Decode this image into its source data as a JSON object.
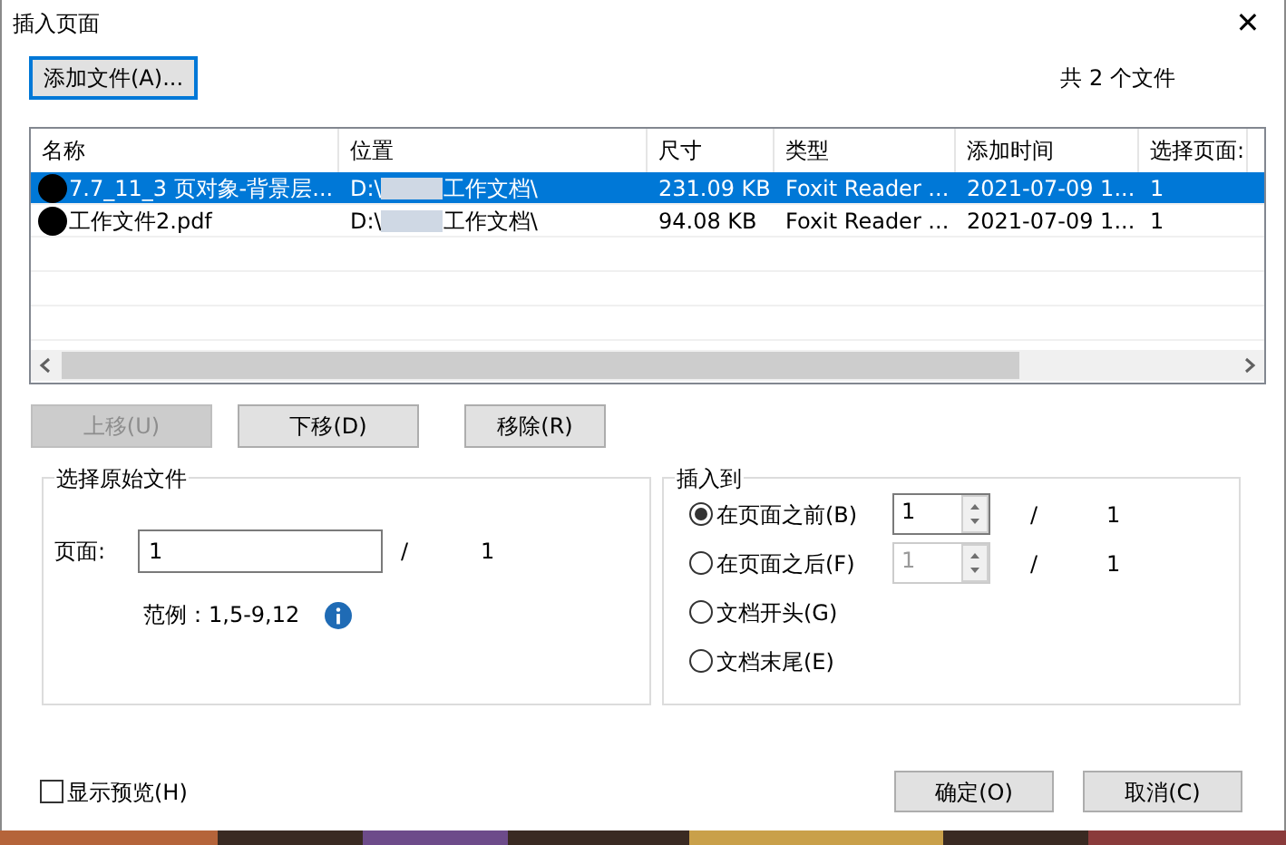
{
  "window": {
    "title": "插入页面",
    "close": "✕"
  },
  "add_button": "添加文件(A)...",
  "file_count": "共 2 个文件",
  "table": {
    "columns": [
      "名称",
      "位置",
      "尺寸",
      "类型",
      "添加时间",
      "选择页面:"
    ],
    "rows": [
      {
        "selected": true,
        "name": "7.7_11_3 页对象-背景层...",
        "location_prefix": "D:\\",
        "location_suffix": "工作文档\\",
        "size": "231.09 KB",
        "type": "Foxit Reader ...",
        "added": "2021-07-09 1...",
        "pages": "1"
      },
      {
        "selected": false,
        "name": "工作文件2.pdf",
        "location_prefix": "D:\\",
        "location_suffix": "工作文档\\",
        "size": "94.08 KB",
        "type": "Foxit Reader ...",
        "added": "2021-07-09 1...",
        "pages": "1"
      }
    ]
  },
  "move_buttons": [
    {
      "label": "上移(U)",
      "disabled": true
    },
    {
      "label": "下移(D)",
      "disabled": false
    },
    {
      "label": "移除(R)",
      "disabled": false
    }
  ],
  "source": {
    "title": "选择原始文件",
    "page_label": "页面:",
    "page_value": "1",
    "slash": "/",
    "page_total": "1",
    "example": "范例：1,5-9,12"
  },
  "insert": {
    "title": "插入到",
    "options": [
      {
        "label": "在页面之前(B)",
        "selected": true,
        "spin_value": "1",
        "slash": "/",
        "total": "1"
      },
      {
        "label": "在页面之后(F)",
        "selected": false,
        "spin_value": "1",
        "slash": "/",
        "total": "1"
      },
      {
        "label": "文档开头(G)",
        "selected": false
      },
      {
        "label": "文档末尾(E)",
        "selected": false
      }
    ]
  },
  "preview": {
    "label": "显示预览(H)",
    "checked": false
  },
  "buttons": [
    "确定(O)",
    "取消(C)"
  ]
}
